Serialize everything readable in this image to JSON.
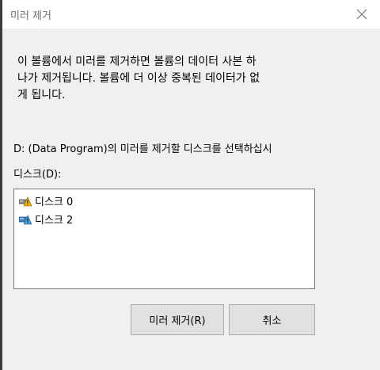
{
  "window": {
    "title": "미러 제거"
  },
  "message": {
    "line1": "이 볼륨에서 미러를 제거하면 볼륨의 데이터 사본 하",
    "line2": "나가 제거됩니다. 볼륨에 더 이상 중복된 데이터가 없",
    "line3": "게 됩니다."
  },
  "instruction": "D: (Data  Program)의 미러를 제거할 디스크를 선택하십시",
  "disk_list": {
    "label": "디스크(D):",
    "items": [
      {
        "label": "디스크 0",
        "icon": "disk-warning-icon"
      },
      {
        "label": "디스크 2",
        "icon": "disk-error-icon"
      }
    ]
  },
  "buttons": {
    "remove": "미러 제거(R)",
    "cancel": "취소"
  },
  "colors": {
    "background": "#f0f0f0",
    "titlebar": "#ffffff",
    "list_bg": "#ffffff",
    "button_bg": "#e1e1e1"
  }
}
